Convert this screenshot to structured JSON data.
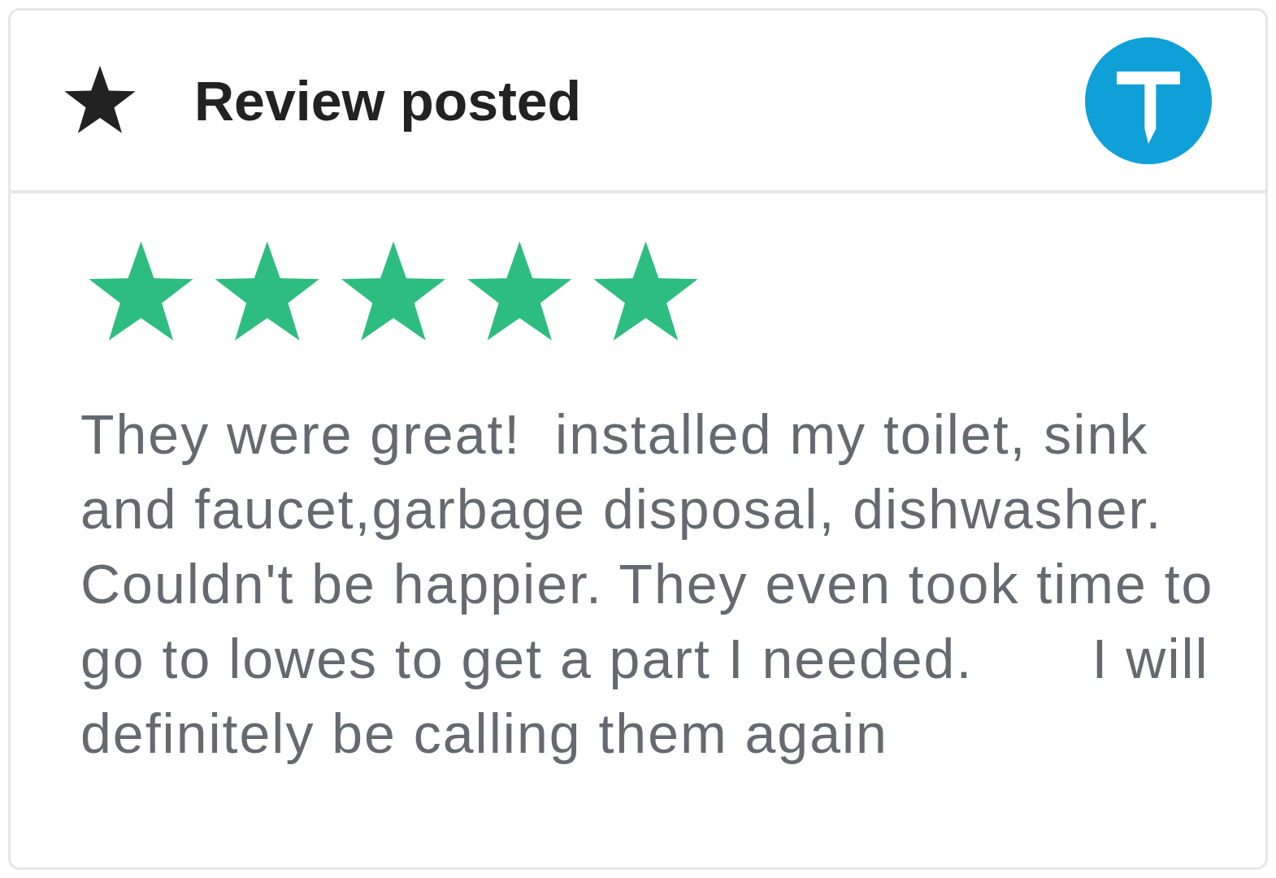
{
  "header": {
    "title": "Review posted"
  },
  "review": {
    "stars": 5,
    "text": "They were great!  installed my toilet, sink and faucet,garbage disposal, dishwasher. Couldn't be happier. They even took time to go to lowes to get a part I needed.       I will definitely be calling them again"
  }
}
